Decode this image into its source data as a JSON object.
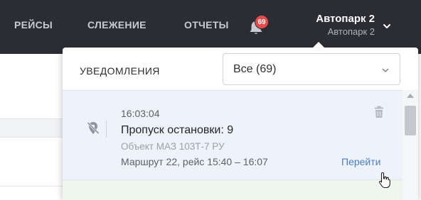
{
  "nav": {
    "items": [
      {
        "label": "РЕЙСЫ"
      },
      {
        "label": "СЛЕЖЕНИЕ"
      },
      {
        "label": "ОТЧЕТЫ"
      }
    ],
    "notification_badge": "69"
  },
  "account": {
    "name": "Автопарк 2",
    "subtitle": "Автопарк 2"
  },
  "popup": {
    "title": "УВЕДОМЛЕНИЯ",
    "filter_value": "Все (69)",
    "notification": {
      "time": "16:03:04",
      "title": "Пропуск остановки: 9",
      "object": "Объект МАЗ 103Т-7 РУ",
      "route": "Маршрут 22, рейс 15:40 – 16:07",
      "action": "Перейти"
    }
  },
  "icons": {
    "bell": "bell-icon",
    "chevron": "chevron-down-icon",
    "location_off": "location-off-icon",
    "trash": "trash-icon"
  },
  "colors": {
    "topbar": "#2b2d33",
    "badge": "#e94b4b",
    "link": "#4a7fc7",
    "notification_bg": "#eef3fb"
  }
}
